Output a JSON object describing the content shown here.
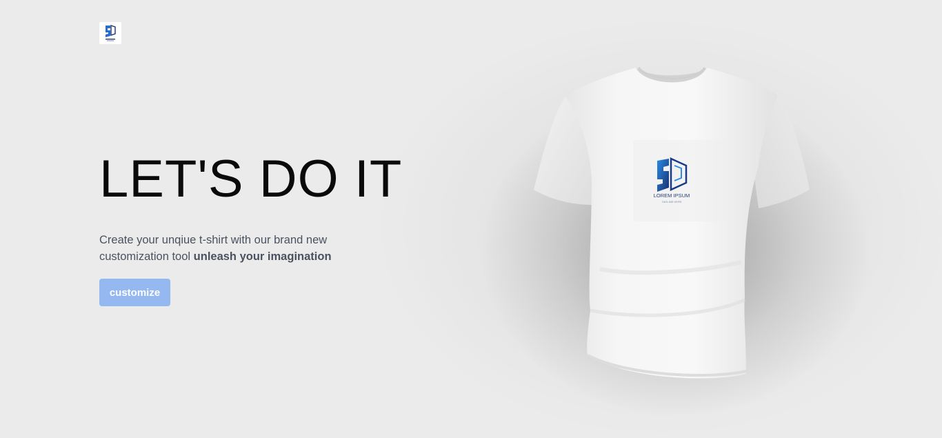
{
  "brand": {
    "logo_icon": "brand-logo-icon",
    "logo_text": "LOREM IPSUM",
    "logo_tagline": "TAGLINE HERE"
  },
  "hero": {
    "title": "LET'S DO IT",
    "description": "Create your unqiue t-shirt with our brand new customization tool ",
    "description_bold": "unleash your imagination",
    "cta_label": "customize"
  },
  "colors": {
    "background": "#e9e9e9",
    "title": "#0a0a0a",
    "text": "#4a5260",
    "button": "#94b8ef",
    "shirt": "#f4f4f4",
    "logo_blue": "#1f6fd6",
    "logo_navy": "#1a2f6e"
  },
  "product": {
    "image": "t-shirt-icon"
  }
}
